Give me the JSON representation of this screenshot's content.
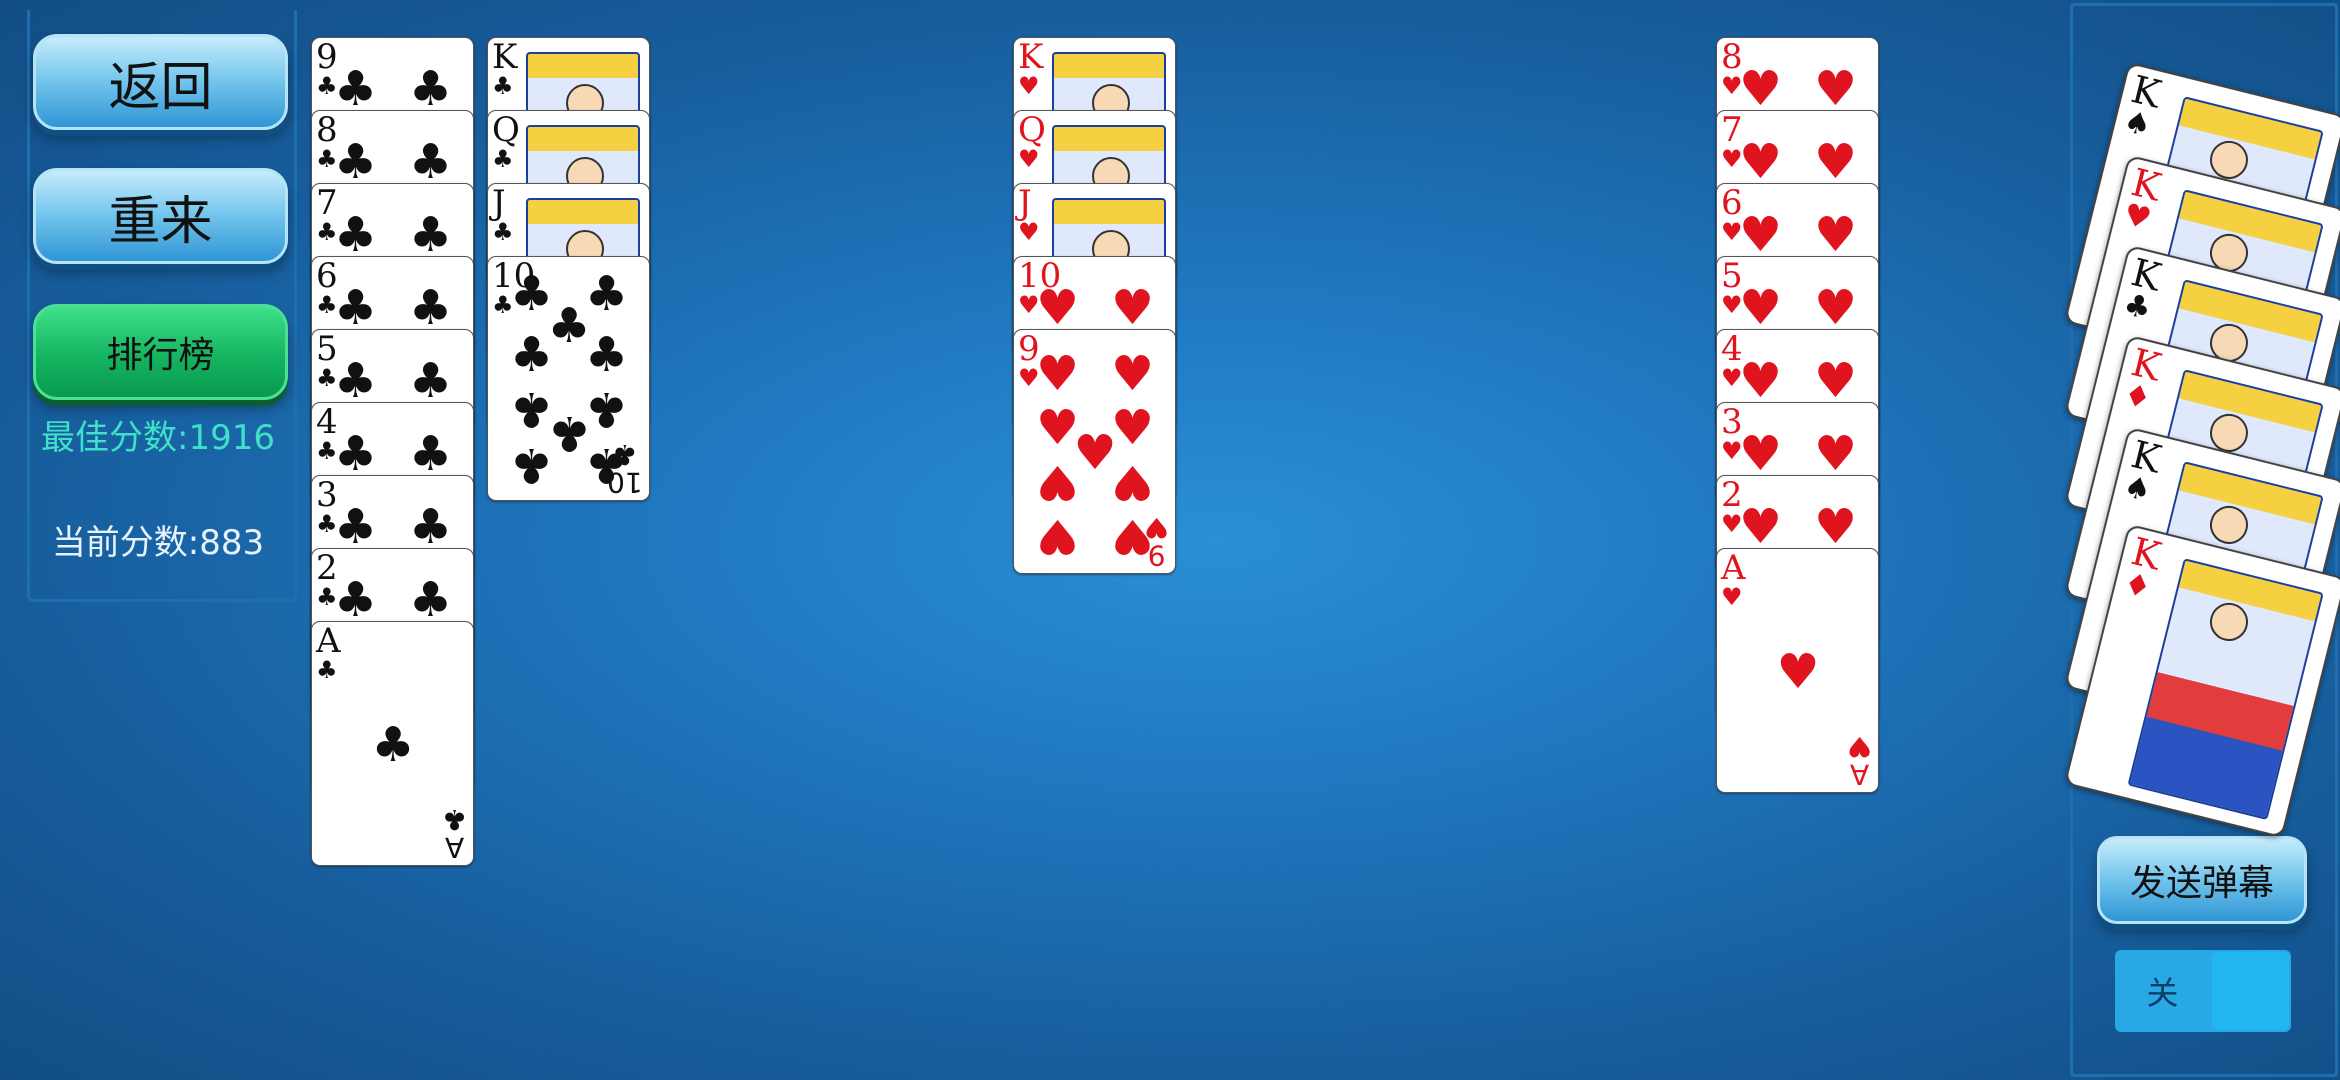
{
  "controls": {
    "back_label": "返回",
    "restart_label": "重来",
    "leaderboard_label": "排行榜",
    "best_score": "最佳分数:1916",
    "current_score": "当前分数:883"
  },
  "colors": {
    "background": "#1f76bd",
    "button_blue": "#79c8ee",
    "button_green": "#14b461",
    "best_score_text": "#3fe0c8",
    "red_suit": "#e0141e"
  },
  "tableau": [
    {
      "cards": [
        {
          "rank": "9",
          "suit": "♣",
          "color": "black"
        },
        {
          "rank": "8",
          "suit": "♣",
          "color": "black"
        },
        {
          "rank": "7",
          "suit": "♣",
          "color": "black"
        },
        {
          "rank": "6",
          "suit": "♣",
          "color": "black"
        },
        {
          "rank": "5",
          "suit": "♣",
          "color": "black"
        },
        {
          "rank": "4",
          "suit": "♣",
          "color": "black"
        },
        {
          "rank": "3",
          "suit": "♣",
          "color": "black"
        },
        {
          "rank": "2",
          "suit": "♣",
          "color": "black"
        },
        {
          "rank": "A",
          "suit": "♣",
          "color": "black"
        }
      ]
    },
    {
      "cards": [
        {
          "rank": "K",
          "suit": "♣",
          "color": "black"
        },
        {
          "rank": "Q",
          "suit": "♣",
          "color": "black"
        },
        {
          "rank": "J",
          "suit": "♣",
          "color": "black"
        },
        {
          "rank": "10",
          "suit": "♣",
          "color": "black"
        }
      ]
    },
    {
      "cards": [
        {
          "rank": "K",
          "suit": "♥",
          "color": "red"
        },
        {
          "rank": "Q",
          "suit": "♥",
          "color": "red"
        },
        {
          "rank": "J",
          "suit": "♥",
          "color": "red"
        },
        {
          "rank": "10",
          "suit": "♥",
          "color": "red"
        },
        {
          "rank": "9",
          "suit": "♥",
          "color": "red"
        }
      ]
    },
    {
      "cards": [
        {
          "rank": "8",
          "suit": "♥",
          "color": "red"
        },
        {
          "rank": "7",
          "suit": "♥",
          "color": "red"
        },
        {
          "rank": "6",
          "suit": "♥",
          "color": "red"
        },
        {
          "rank": "5",
          "suit": "♥",
          "color": "red"
        },
        {
          "rank": "4",
          "suit": "♥",
          "color": "red"
        },
        {
          "rank": "3",
          "suit": "♥",
          "color": "red"
        },
        {
          "rank": "2",
          "suit": "♥",
          "color": "red"
        },
        {
          "rank": "A",
          "suit": "♥",
          "color": "red"
        }
      ]
    }
  ],
  "completed_kings": [
    {
      "rank": "K",
      "suit": "♠",
      "color": "black"
    },
    {
      "rank": "K",
      "suit": "♥",
      "color": "red"
    },
    {
      "rank": "K",
      "suit": "♣",
      "color": "black"
    },
    {
      "rank": "K",
      "suit": "♦",
      "color": "red"
    },
    {
      "rank": "K",
      "suit": "♠",
      "color": "black"
    },
    {
      "rank": "K",
      "suit": "♦",
      "color": "red"
    }
  ],
  "danmaku": {
    "send_label": "发送弹幕",
    "toggle_label": "关"
  }
}
